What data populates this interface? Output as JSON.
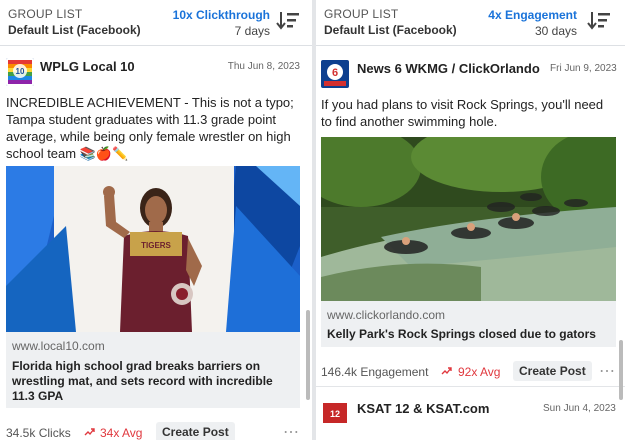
{
  "left": {
    "header": {
      "group_label": "GROUP LIST",
      "list_name": "Default List (Facebook)",
      "metric": "10x Clickthrough",
      "period": "7 days"
    },
    "post": {
      "source": "WPLG Local 10",
      "date": "Thu Jun 8, 2023",
      "text": "INCREDIBLE ACHIEVEMENT - This is not a typo; Tampa student graduates with 11.3 grade point average, while being only female wrestler on high school team 📚🍎✏️",
      "link_url": "www.local10.com",
      "link_title": "Florida high school grad breaks barriers on wrestling mat, and sets record with incredible 11.3 GPA",
      "stat": "34.5k Clicks",
      "avg": "34x Avg",
      "button": "Create Post"
    }
  },
  "right": {
    "header": {
      "group_label": "GROUP LIST",
      "list_name": "Default List (Facebook)",
      "metric": "4x Engagement",
      "period": "30 days"
    },
    "post": {
      "source": "News 6 WKMG / ClickOrlando",
      "date": "Fri Jun 9, 2023",
      "text": "If you had plans to visit Rock Springs, you'll need to find another swimming hole.",
      "link_url": "www.clickorlando.com",
      "link_title": "Kelly Park's Rock Springs closed due to gators",
      "stat": "146.4k Engagement",
      "avg": "92x Avg",
      "button": "Create Post"
    },
    "next_post": {
      "source": "KSAT 12 & KSAT.com",
      "date": "Sun Jun 4, 2023"
    }
  },
  "colors": {
    "accent": "#1a73d9",
    "avg_red": "#e0383e",
    "wrestler_singlet": "#6b1f2e",
    "wrestler_gold": "#c8a24a"
  }
}
